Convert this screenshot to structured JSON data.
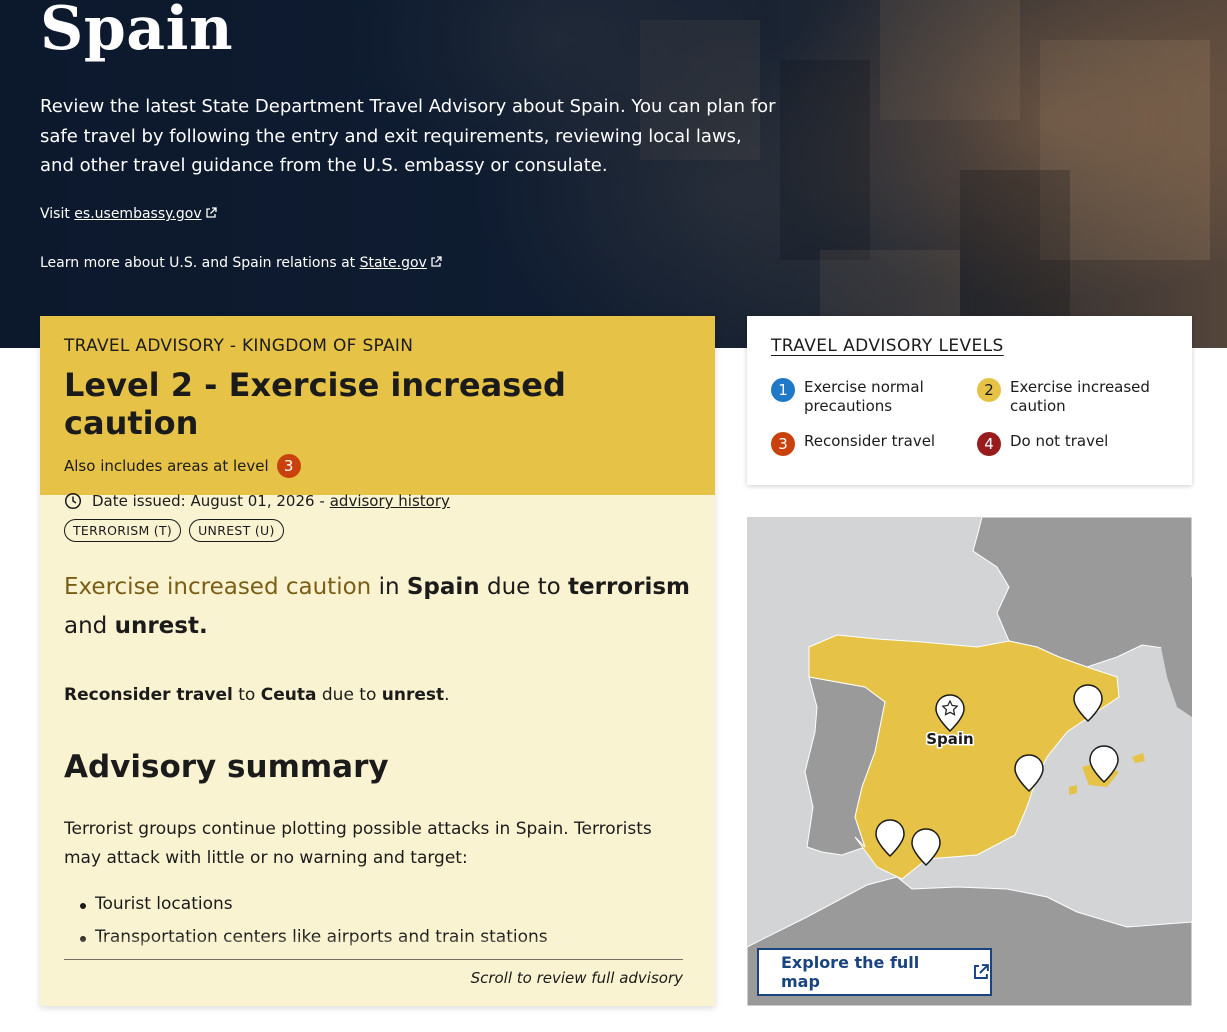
{
  "hero": {
    "title": "Spain",
    "description": "Review the latest State Department Travel Advisory about Spain. You can plan for safe travel by following the entry and exit requirements, reviewing local laws, and other travel guidance from the U.S. embassy or consulate.",
    "visit_prefix": "Visit",
    "embassy_link": "es.usembassy.gov",
    "relations_prefix": "Learn more about U.S. and Spain relations at",
    "state_link": "State.gov"
  },
  "advisory": {
    "kicker": "TRAVEL ADVISORY - KINGDOM OF SPAIN",
    "level_title": "Level 2 - Exercise increased caution",
    "also_includes": "Also includes areas at level",
    "also_level": "3",
    "date_issued": "Date issued: August 01, 2026 -",
    "history_link": "advisory history",
    "tags": [
      "TERRORISM (T)",
      "UNREST (U)"
    ],
    "lead": {
      "highlight": "Exercise increased caution",
      "in": "in",
      "country": "Spain",
      "due_to": "due to",
      "reason1": "terrorism",
      "and": "and",
      "reason2": "unrest."
    },
    "reconsider": {
      "action": "Reconsider travel",
      "to": "to",
      "place": "Ceuta",
      "due_to": "due to",
      "reason": "unrest",
      "end": "."
    },
    "summary_title": "Advisory summary",
    "summary_text": "Terrorist groups continue plotting possible attacks in Spain. Terrorists may attack with little or no warning and target:",
    "bullets": [
      "Tourist locations",
      "Transportation centers like airports and train stations"
    ],
    "scroll_note": "Scroll to review full advisory"
  },
  "levels": {
    "title": "TRAVEL ADVISORY LEVELS",
    "items": [
      {
        "num": "1",
        "label": "Exercise normal precautions",
        "color": "#1f78c8"
      },
      {
        "num": "2",
        "label": "Exercise increased caution",
        "color": "#e6c346"
      },
      {
        "num": "3",
        "label": "Reconsider travel",
        "color": "#c9420d"
      },
      {
        "num": "4",
        "label": "Do not travel",
        "color": "#981b1e"
      }
    ]
  },
  "map": {
    "country_label": "Spain",
    "button_label": "Explore the full map",
    "colors": {
      "land": "#9a9a9a",
      "sea": "#d2d4d6",
      "spain": "#e6c346"
    }
  }
}
